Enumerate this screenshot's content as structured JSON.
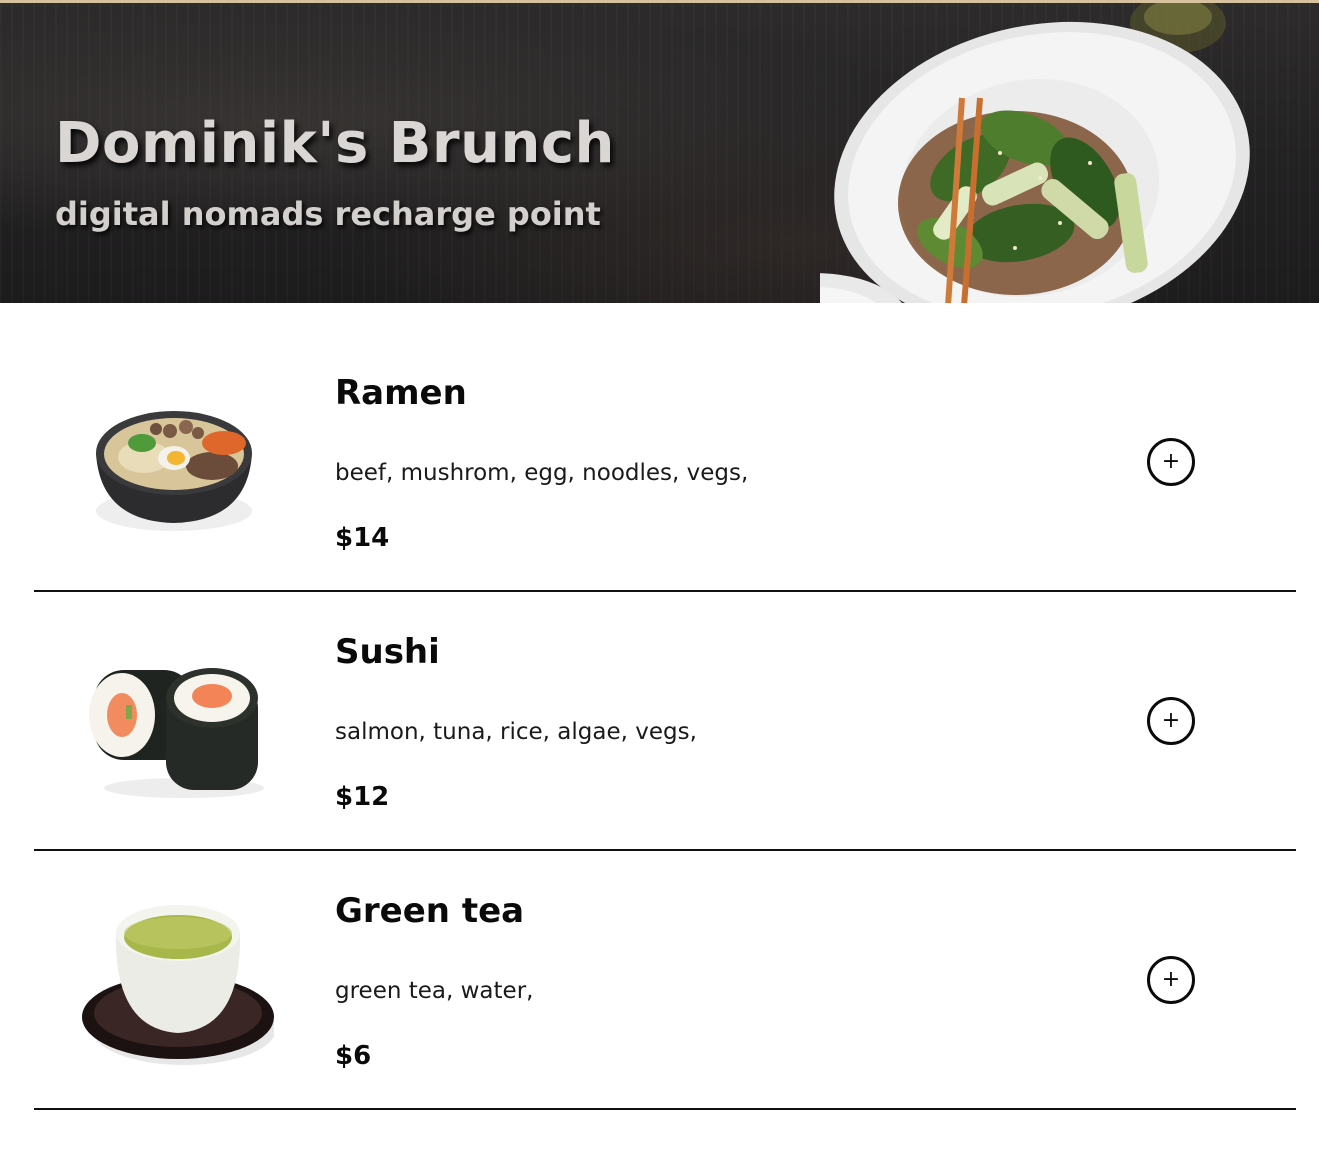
{
  "header": {
    "title": "Dominik's Brunch",
    "subtitle": "digital nomads recharge point"
  },
  "menu": {
    "items": [
      {
        "name": "Ramen",
        "ingredients": "beef, mushrom, egg, noodles, vegs,",
        "price": "$14",
        "image_icon": "ramen-bowl-icon",
        "add_label": "+"
      },
      {
        "name": "Sushi",
        "ingredients": "salmon, tuna, rice, algae, vegs,",
        "price": "$12",
        "image_icon": "sushi-rolls-icon",
        "add_label": "+"
      },
      {
        "name": "Green tea",
        "ingredients": "green tea, water,",
        "price": "$6",
        "image_icon": "green-tea-cup-icon",
        "add_label": "+"
      }
    ]
  },
  "colors": {
    "hero_background": "#232223",
    "hero_top_border": "#d7c2a0",
    "hero_text": "#d9d6d4",
    "item_text": "#0a0a0a",
    "divider": "#111111"
  }
}
